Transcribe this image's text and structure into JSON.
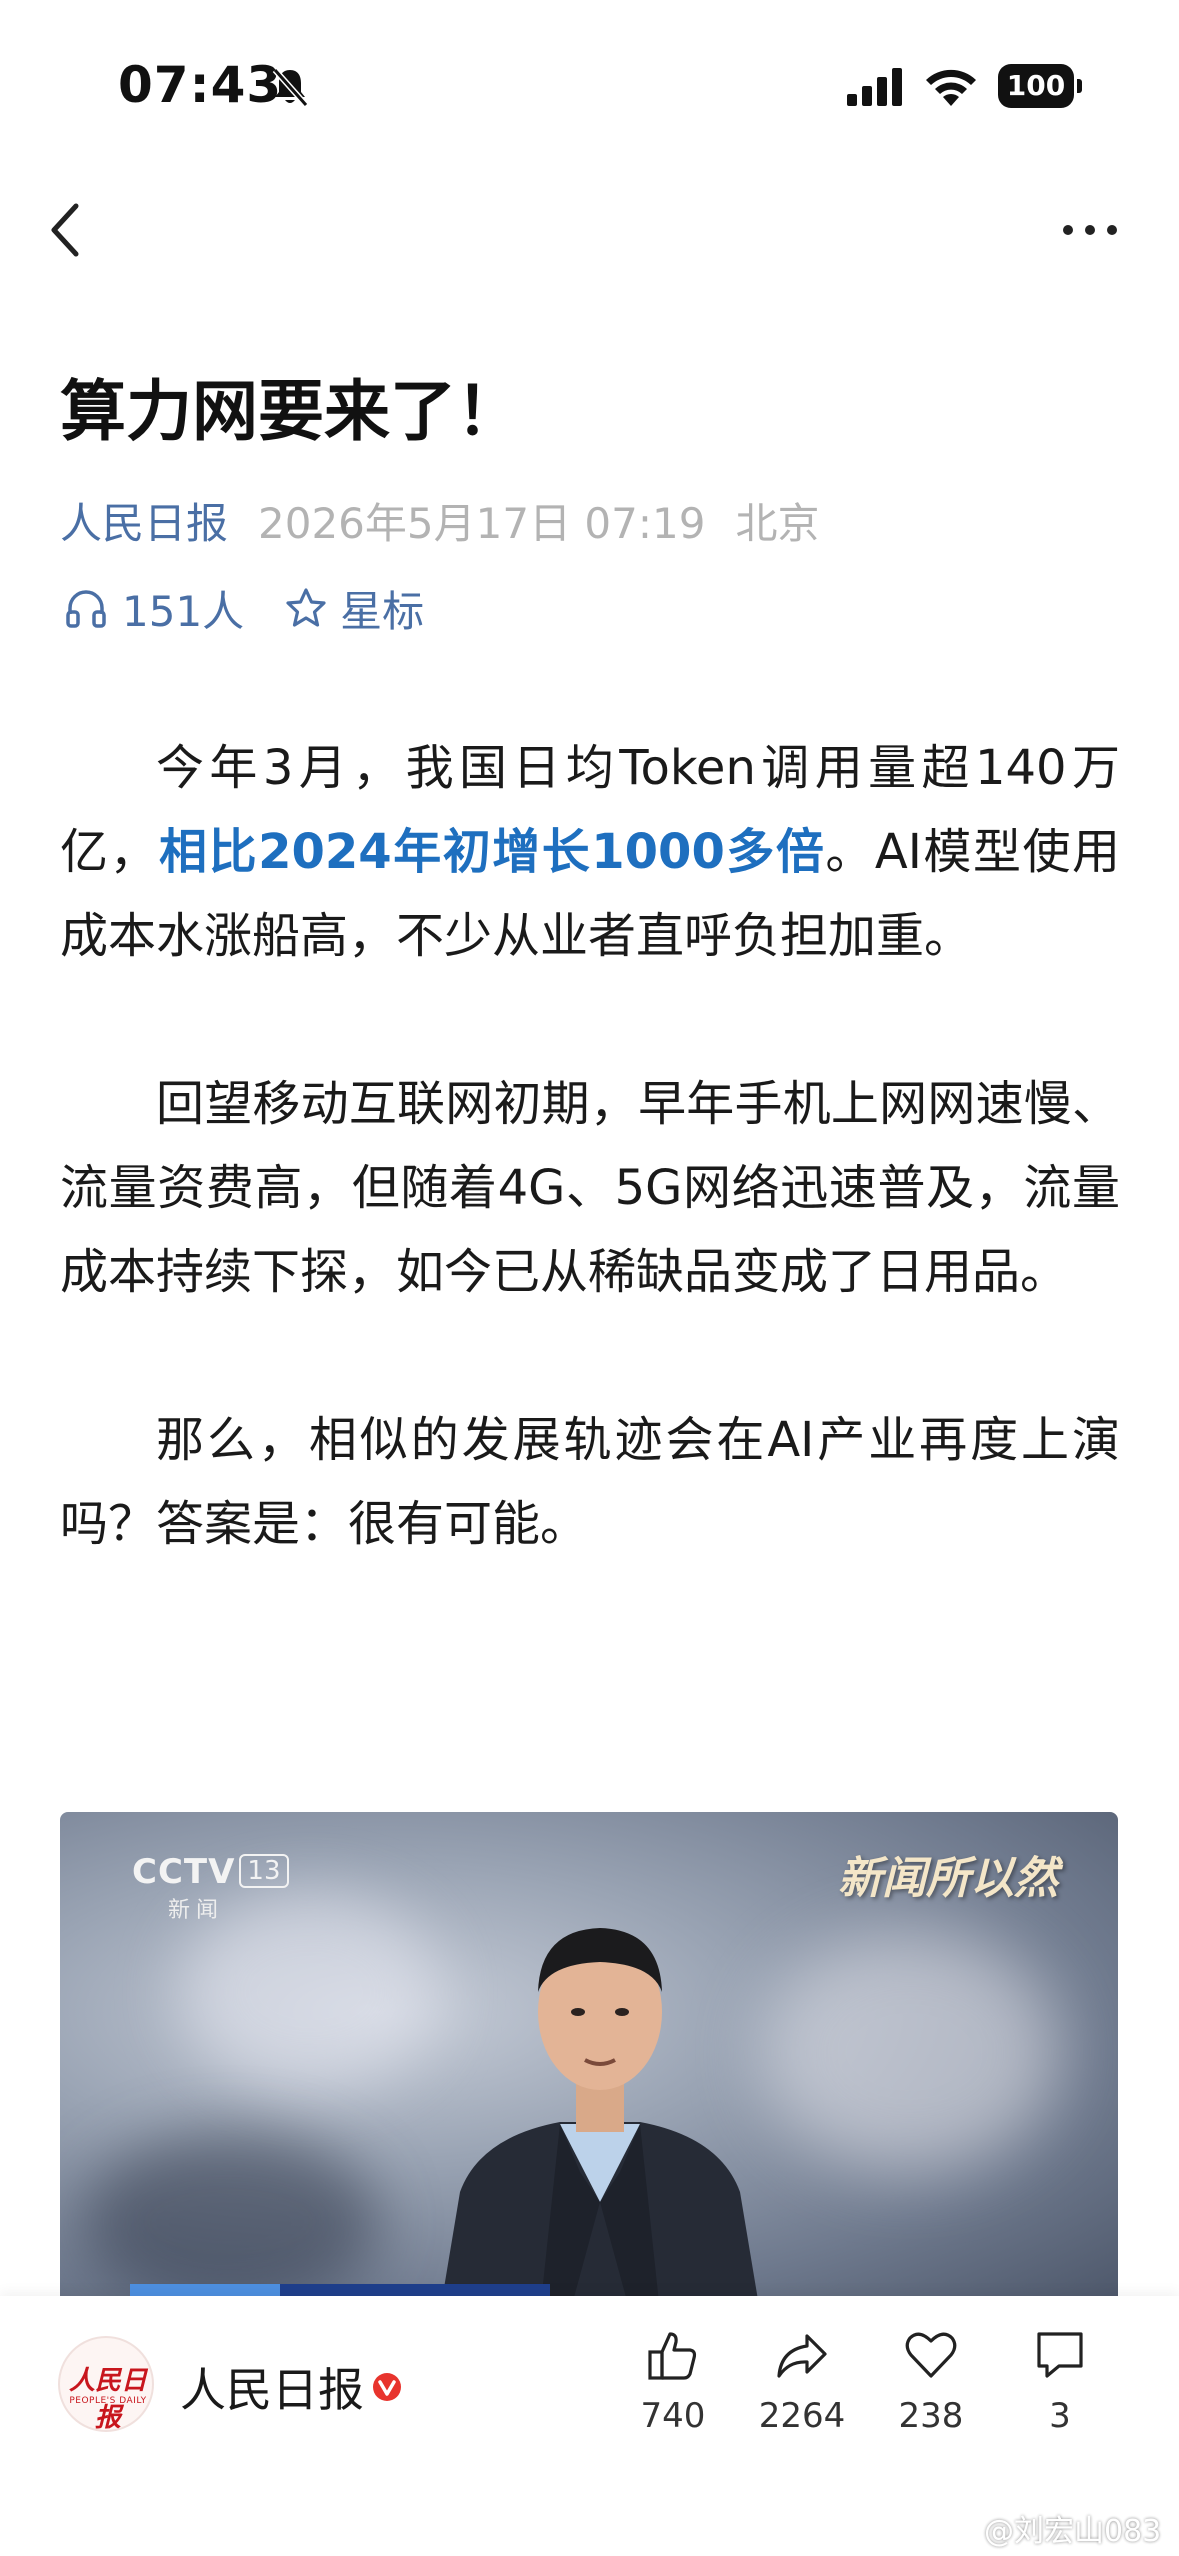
{
  "status_bar": {
    "time": "07:43",
    "battery": "100"
  },
  "nav": {
    "back_icon": "chevron-left-icon",
    "more_icon": "more-horizontal-icon"
  },
  "article": {
    "title": "算力网要来了！",
    "source": "人民日报",
    "date": "2026年5月17日 07:19",
    "location": "北京",
    "listeners": "151人",
    "star_label": "星标",
    "paragraphs": [
      {
        "before": "今年3月，我国日均Token调用量超140万亿，",
        "highlight": "相比2024年初增长1000多倍",
        "after": "。AI模型使用成本水涨船高，不少从业者直呼负担加重。"
      },
      {
        "text": "回望移动互联网初期，早年手机上网网速慢、流量资费高，但随着4G、5G网络迅速普及，流量成本持续下探，如今已从稀缺品变成了日用品。"
      },
      {
        "text": "那么，相似的发展轨迹会在AI产业再度上演吗？答案是：很有可能。"
      }
    ],
    "highlight_color": "#1e6fbf"
  },
  "video": {
    "channel": "CCTV",
    "channel_number": "13",
    "channel_sub": "新闻",
    "show_name": "新闻所以然"
  },
  "bottom_bar": {
    "publisher": "人民日报",
    "avatar_text": "人民日报",
    "avatar_sub": "PEOPLE'S DAILY",
    "actions": {
      "like_count": "740",
      "share_count": "2264",
      "favorite_count": "238",
      "comment_count": "3"
    }
  },
  "watermark": "@刘宏山083",
  "colors": {
    "link_blue": "#4a6fa5",
    "meta_gray": "#b3b3b3",
    "brand_red": "#c8161d"
  }
}
